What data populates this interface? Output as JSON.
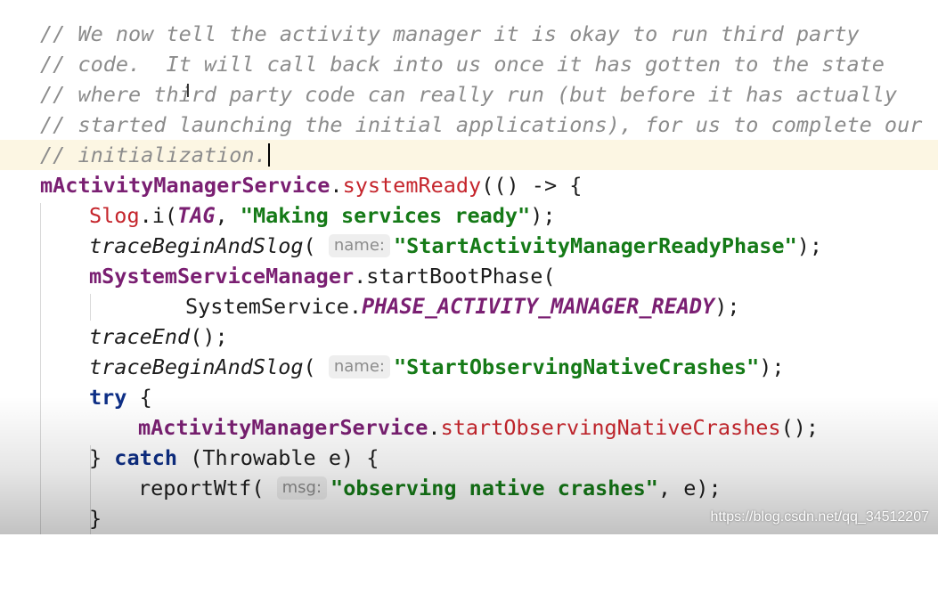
{
  "watermark": "https://blog.csdn.net/qq_34512207",
  "code": {
    "l1": "// We now tell the activity manager it is okay to run third party",
    "l2": "// code.  It will call back into us once it has gotten to the state",
    "l3": "// where third party code can really run (but before it has actually",
    "l4": "// started launching the initial applications), for us to complete our",
    "l5": "// initialization.",
    "l6": {
      "field": "mActivityManagerService",
      "dot": ".",
      "method": "systemReady",
      "rest": "(() -> {"
    },
    "l7": {
      "cls": "Slog",
      "call": ".i(",
      "tag": "TAG",
      "comma": ", ",
      "str": "\"Making services ready\"",
      "end": ");"
    },
    "l8": {
      "call": "traceBeginAndSlog",
      "open": "(",
      "hint": "name:",
      "str": "\"StartActivityManagerReadyPhase\"",
      "end": ");"
    },
    "l9": {
      "field": "mSystemServiceManager",
      "rest": ".startBootPhase("
    },
    "l10": {
      "cls": "SystemService.",
      "constant": "PHASE_ACTIVITY_MANAGER_READY",
      "end": ");"
    },
    "l11": {
      "call": "traceEnd",
      "end": "();"
    },
    "l12": {
      "call": "traceBeginAndSlog",
      "open": "(",
      "hint": "name:",
      "str": "\"StartObservingNativeCrashes\"",
      "end": ");"
    },
    "l13": {
      "kw": "try",
      "rest": " {"
    },
    "l14": {
      "field": "mActivityManagerService",
      "dot": ".",
      "method": "startObservingNativeCrashes",
      "end": "();"
    },
    "l15": {
      "open": "} ",
      "kw": "catch",
      "rest": " (Throwable e) {"
    },
    "l16": {
      "call": "reportWtf(",
      "hint": "msg:",
      "str": "\"observing native crashes\"",
      "end": ", e);"
    },
    "l17": "}"
  }
}
